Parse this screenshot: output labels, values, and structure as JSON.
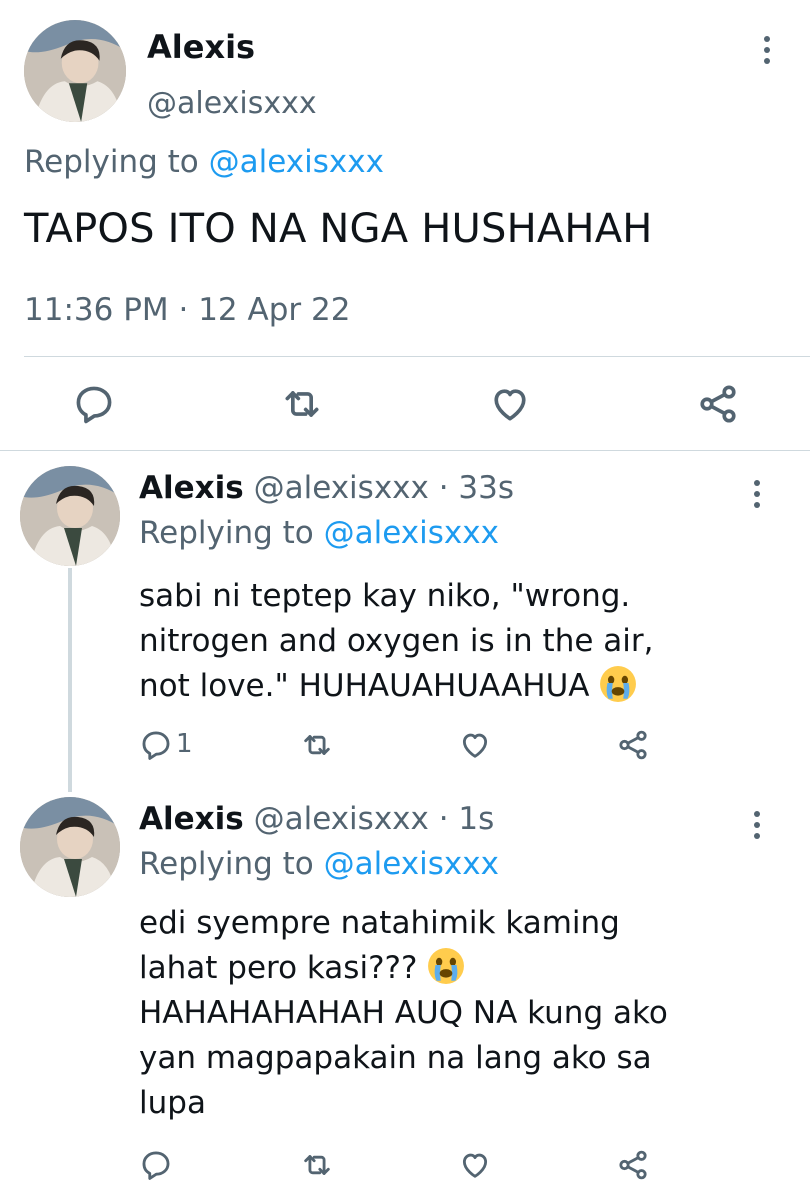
{
  "main_tweet": {
    "author_name": "Alexis",
    "author_handle": "@alexisxxx",
    "replying_prefix": "Replying to",
    "replying_mention": "@alexisxxx",
    "text": "TAPOS ITO NA NGA HUSHAHAH",
    "timestamp": "11:36 PM · 12 Apr 22",
    "actions": [
      "reply-icon",
      "retweet-icon",
      "like-icon",
      "share-icon"
    ]
  },
  "replies": [
    {
      "author_name": "Alexis",
      "handle_time": "@alexisxxx · 33s",
      "replying_prefix": "Replying to",
      "replying_mention": "@alexisxxx",
      "lines": [
        "sabi ni teptep kay niko, \"wrong.",
        "nitrogen and oxygen is in the air,",
        "not love.\" HUHAUAHUAAHUA"
      ],
      "reply_count": "1"
    },
    {
      "author_name": "Alexis",
      "handle_time": "@alexisxxx · 1s",
      "replying_prefix": "Replying to",
      "replying_mention": "@alexisxxx",
      "lines": [
        "edi syempre natahimik kaming",
        "lahat pero kasi???",
        "HAHAHAHAHAH AUQ NA kung ako",
        "yan magpapakain na lang ako sa",
        "lupa"
      ],
      "reply_count": ""
    }
  ],
  "colors": {
    "text": "#0f1419",
    "secondary": "#536471",
    "link": "#1d9bf0",
    "divider": "#cfd9de",
    "emoji": "#ffcc4d"
  }
}
